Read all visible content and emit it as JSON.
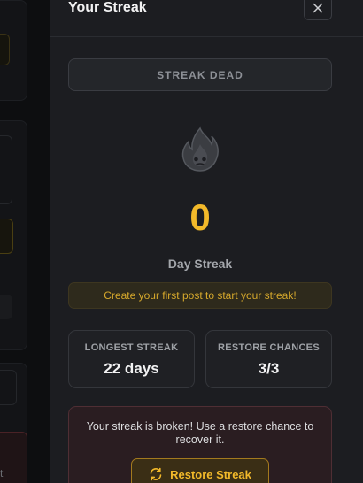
{
  "background": {
    "fragment_text": "t"
  },
  "modal": {
    "title": "Your Streak",
    "close_icon": "close-icon"
  },
  "streak": {
    "status": "STREAK DEAD",
    "icon": "flame-icon",
    "count": "0",
    "count_label": "Day Streak",
    "hint": "Create your first post to start your streak!"
  },
  "stats": [
    {
      "label": "LONGEST STREAK",
      "value": "22 days"
    },
    {
      "label": "RESTORE CHANCES",
      "value": "3/3"
    }
  ],
  "restore": {
    "message": "Your streak is broken! Use a restore chance to recover it.",
    "button_label": "Restore Streak",
    "button_icon": "refresh-icon"
  },
  "colors": {
    "accent": "#f2b92a",
    "danger_bg": "#2a1d21",
    "modal_bg": "#1c1d21"
  }
}
